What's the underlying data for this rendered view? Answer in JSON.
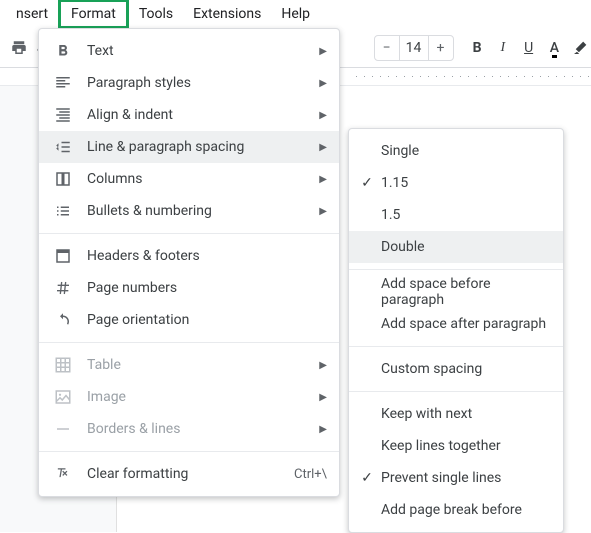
{
  "menubar": {
    "items": [
      "nsert",
      "Format",
      "Tools",
      "Extensions",
      "Help"
    ]
  },
  "toolbar": {
    "font_size": "14",
    "bold": "B",
    "italic": "I",
    "underline": "U",
    "text_color": "A"
  },
  "format_menu": {
    "items": [
      {
        "label": "Text",
        "submenu": true
      },
      {
        "label": "Paragraph styles",
        "submenu": true
      },
      {
        "label": "Align & indent",
        "submenu": true
      },
      {
        "label": "Line & paragraph spacing",
        "submenu": true,
        "highlighted": true
      },
      {
        "label": "Columns",
        "submenu": true
      },
      {
        "label": "Bullets & numbering",
        "submenu": true
      },
      {
        "label": "Headers & footers"
      },
      {
        "label": "Page numbers"
      },
      {
        "label": "Page orientation"
      },
      {
        "label": "Table",
        "submenu": true,
        "disabled": true
      },
      {
        "label": "Image",
        "submenu": true,
        "disabled": true
      },
      {
        "label": "Borders & lines",
        "submenu": true,
        "disabled": true
      },
      {
        "label": "Clear formatting",
        "shortcut": "Ctrl+\\"
      }
    ]
  },
  "spacing_menu": {
    "items": [
      {
        "label": "Single"
      },
      {
        "label": "1.15",
        "checked": true
      },
      {
        "label": "1.5"
      },
      {
        "label": "Double",
        "highlighted": true
      },
      {
        "label": "Add space before paragraph"
      },
      {
        "label": "Add space after paragraph"
      },
      {
        "label": "Custom spacing"
      },
      {
        "label": "Keep with next"
      },
      {
        "label": "Keep lines together"
      },
      {
        "label": "Prevent single lines",
        "checked": true
      },
      {
        "label": "Add page break before"
      }
    ]
  }
}
